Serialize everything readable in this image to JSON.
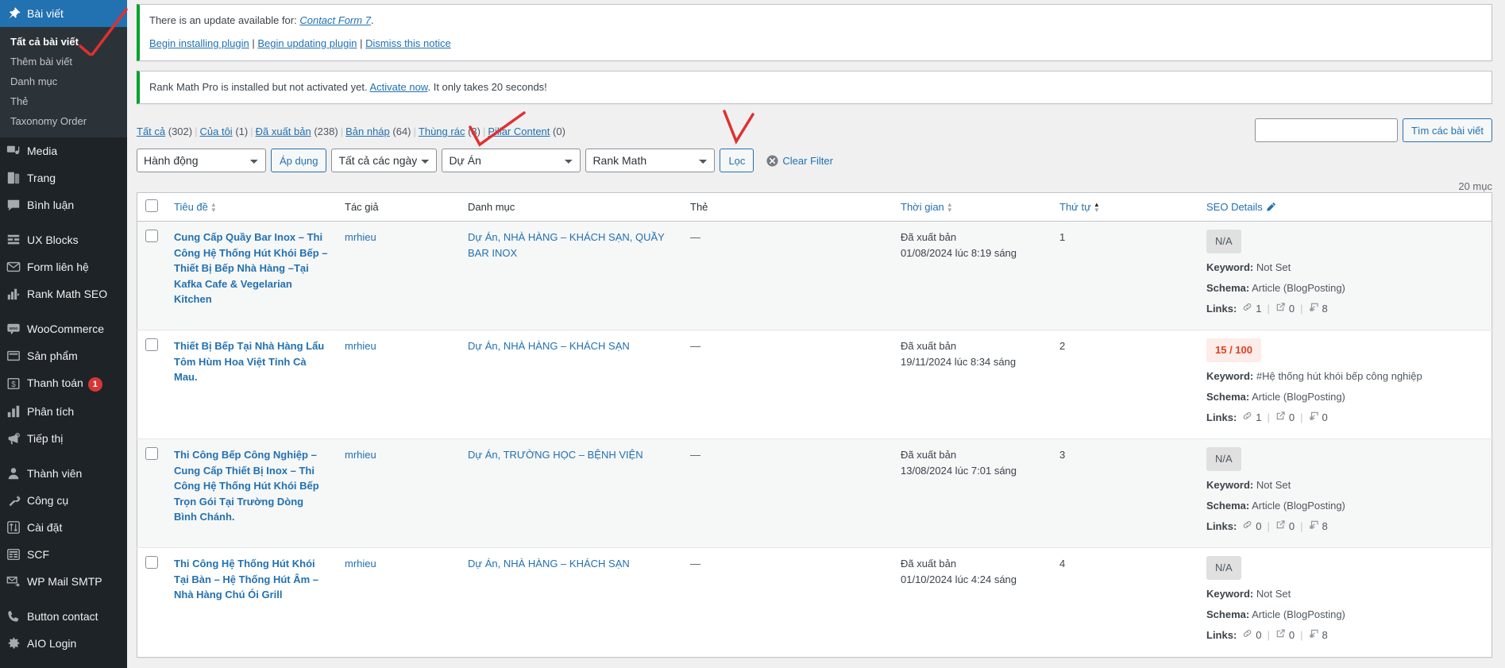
{
  "sidebar": {
    "items": [
      {
        "label": "Bài viết",
        "icon": "pin-icon",
        "current": true,
        "badge": null
      },
      {
        "label": "Media",
        "icon": "media-icon",
        "current": false,
        "badge": null
      },
      {
        "label": "Trang",
        "icon": "page-icon",
        "current": false,
        "badge": null
      },
      {
        "label": "Bình luận",
        "icon": "comment-icon",
        "current": false,
        "badge": null
      },
      {
        "label": "UX Blocks",
        "icon": "blocks-icon",
        "current": false,
        "badge": null
      },
      {
        "label": "Form liên hệ",
        "icon": "mail-icon",
        "current": false,
        "badge": null
      },
      {
        "label": "Rank Math SEO",
        "icon": "rankmath-icon",
        "current": false,
        "badge": null
      },
      {
        "label": "WooCommerce",
        "icon": "woo-icon",
        "current": false,
        "badge": null
      },
      {
        "label": "Sản phẩm",
        "icon": "product-icon",
        "current": false,
        "badge": null
      },
      {
        "label": "Thanh toán",
        "icon": "payment-icon",
        "current": false,
        "badge": "1"
      },
      {
        "label": "Phân tích",
        "icon": "chart-icon",
        "current": false,
        "badge": null
      },
      {
        "label": "Tiếp thị",
        "icon": "megaphone-icon",
        "current": false,
        "badge": null
      },
      {
        "label": "Thành viên",
        "icon": "user-icon",
        "current": false,
        "badge": null
      },
      {
        "label": "Công cụ",
        "icon": "wrench-icon",
        "current": false,
        "badge": null
      },
      {
        "label": "Cài đặt",
        "icon": "settings-icon",
        "current": false,
        "badge": null
      },
      {
        "label": "SCF",
        "icon": "scf-icon",
        "current": false,
        "badge": null
      },
      {
        "label": "WP Mail SMTP",
        "icon": "smtp-icon",
        "current": false,
        "badge": null
      },
      {
        "label": "Button contact",
        "icon": "phone-icon",
        "current": false,
        "badge": null
      },
      {
        "label": "AIO Login",
        "icon": "gear-icon",
        "current": false,
        "badge": null
      }
    ],
    "submenu": [
      {
        "label": "Tất cả bài viết",
        "current": true
      },
      {
        "label": "Thêm bài viết",
        "current": false
      },
      {
        "label": "Danh mục",
        "current": false
      },
      {
        "label": "Thẻ",
        "current": false
      },
      {
        "label": "Taxonomy Order",
        "current": false
      }
    ]
  },
  "notices": [
    {
      "text_before": "There is an update available for: ",
      "link_text": "Contact Form 7",
      "text_after": ".",
      "actions": [
        "Begin installing plugin",
        "Begin updating plugin",
        "Dismiss this notice"
      ]
    },
    {
      "text_before": "Rank Math Pro is installed but not activated yet. ",
      "link_text": "Activate now",
      "text_after": ". It only takes 20 seconds!",
      "actions": []
    }
  ],
  "status_links": [
    {
      "label": "Tất cả",
      "count": "(302)"
    },
    {
      "label": "Của tôi",
      "count": "(1)"
    },
    {
      "label": "Đã xuất bản",
      "count": "(238)"
    },
    {
      "label": "Bản nháp",
      "count": "(64)"
    },
    {
      "label": "Thùng rác",
      "count": "(3)"
    },
    {
      "label": "Pillar Content",
      "count": "(0)"
    }
  ],
  "search": {
    "value": "",
    "placeholder": "",
    "button_label": "Tìm các bài viết"
  },
  "toolbar": {
    "bulk_action": "Hành động",
    "apply_label": "Áp dụng",
    "date_filter": "Tất cả các ngày",
    "category_filter": "Dự Án",
    "seo_filter": "Rank Math",
    "filter_label": "Lọc",
    "clear_filter_label": "Clear Filter",
    "displaying_num": "20 mục"
  },
  "table": {
    "columns": {
      "title": "Tiêu đề",
      "author": "Tác giả",
      "category": "Danh mục",
      "tags": "Thẻ",
      "date": "Thời gian",
      "order": "Thứ tự",
      "seo": "SEO Details"
    },
    "rows": [
      {
        "title": "Cung Cấp Quầy Bar Inox – Thi Công Hệ Thống Hút Khói Bếp – Thiết Bị Bếp Nhà Hàng –Tại Kafka Cafe & Vegelarian Kitchen",
        "author": "mrhieu",
        "category": "Dự Án, NHÀ HÀNG – KHÁCH SẠN, QUẦY BAR INOX",
        "tags": "—",
        "date_status": "Đã xuất bản",
        "date_value": "01/08/2024 lúc 8:19 sáng",
        "order": "1",
        "seo_score": "N/A",
        "seo_score_type": "na",
        "keyword_label": "Keyword:",
        "keyword_value": "Not Set",
        "schema_label": "Schema:",
        "schema_value": "Article (BlogPosting)",
        "links_label": "Links:",
        "links_internal": "1",
        "links_external": "0",
        "links_incoming": "8"
      },
      {
        "title": "Thiết Bị Bếp Tại Nhà Hàng Lẩu Tôm Hùm Hoa Việt Tỉnh Cà Mau.",
        "author": "mrhieu",
        "category": "Dự Án, NHÀ HÀNG – KHÁCH SẠN",
        "tags": "—",
        "date_status": "Đã xuất bản",
        "date_value": "19/11/2024 lúc 8:34 sáng",
        "order": "2",
        "seo_score": "15 / 100",
        "seo_score_type": "bad",
        "keyword_label": "Keyword:",
        "keyword_value": "#Hệ thống hút khói bếp công nghiệp",
        "schema_label": "Schema:",
        "schema_value": "Article (BlogPosting)",
        "links_label": "Links:",
        "links_internal": "1",
        "links_external": "0",
        "links_incoming": "0"
      },
      {
        "title": "Thi Công Bếp Công Nghiệp – Cung Cấp Thiết Bị Inox – Thi Công Hệ Thống Hút Khói Bếp Trọn Gói Tại Trường Dòng Bình Chánh.",
        "author": "mrhieu",
        "category": "Dự Án, TRƯỜNG HỌC – BỆNH VIỆN",
        "tags": "—",
        "date_status": "Đã xuất bản",
        "date_value": "13/08/2024 lúc 7:01 sáng",
        "order": "3",
        "seo_score": "N/A",
        "seo_score_type": "na",
        "keyword_label": "Keyword:",
        "keyword_value": "Not Set",
        "schema_label": "Schema:",
        "schema_value": "Article (BlogPosting)",
        "links_label": "Links:",
        "links_internal": "0",
        "links_external": "0",
        "links_incoming": "8"
      },
      {
        "title": "Thi Công Hệ Thống Hút Khói Tại Bàn – Hệ Thống Hút Âm – Nhà Hàng Chú Ói Grill",
        "author": "mrhieu",
        "category": "Dự Án, NHÀ HÀNG – KHÁCH SẠN",
        "tags": "—",
        "date_status": "Đã xuất bản",
        "date_value": "01/10/2024 lúc 4:24 sáng",
        "order": "4",
        "seo_score": "N/A",
        "seo_score_type": "na",
        "keyword_label": "Keyword:",
        "keyword_value": "Not Set",
        "schema_label": "Schema:",
        "schema_value": "Article (BlogPosting)",
        "links_label": "Links:",
        "links_internal": "0",
        "links_external": "0",
        "links_incoming": "8"
      }
    ]
  },
  "colors": {
    "accent": "#2271b1",
    "sidebar_bg": "#1d2327",
    "notice_green": "#00a32a",
    "badge_red": "#d63638",
    "annotation_red": "#e03030"
  }
}
